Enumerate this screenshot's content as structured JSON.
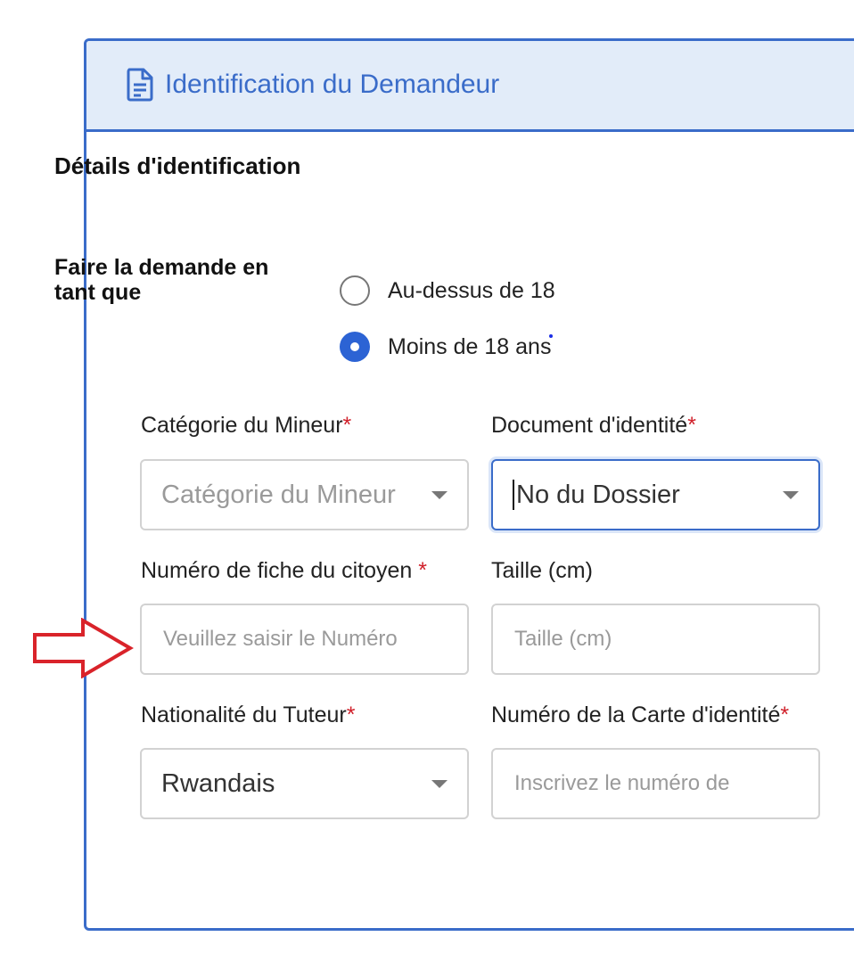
{
  "header": {
    "title": "Identification du Demandeur",
    "icon": "document-icon"
  },
  "section_title": "Détails d'identification",
  "apply_as": {
    "label": "Faire la demande en tant que",
    "options": [
      {
        "label": "Au-dessus de 18",
        "checked": false
      },
      {
        "label": "Moins de 18 ans",
        "checked": true
      }
    ]
  },
  "fields": {
    "minor_category": {
      "label": "Catégorie du Mineur",
      "required": "*",
      "placeholder": "Catégorie du Mineur"
    },
    "id_document": {
      "label": "Document d'identité",
      "required": "*",
      "value": "No du Dossier"
    },
    "citizen_record": {
      "label": "Numéro de fiche du citoyen ",
      "required": "*",
      "placeholder": "Veuillez saisir le Numéro"
    },
    "height": {
      "label": "Taille (cm)",
      "placeholder": "Taille (cm)"
    },
    "guardian_nationality": {
      "label": "Nationalité du Tuteur",
      "required": "*",
      "value": "Rwandais"
    },
    "id_card_number": {
      "label": "Numéro de la Carte d'identité",
      "required": "*",
      "placeholder": "Inscrivez le numéro de"
    }
  },
  "colors": {
    "accent": "#3a6cc9",
    "header_bg": "#e2ecf9",
    "required": "#d0202a",
    "annotation_arrow": "#d9232a"
  }
}
